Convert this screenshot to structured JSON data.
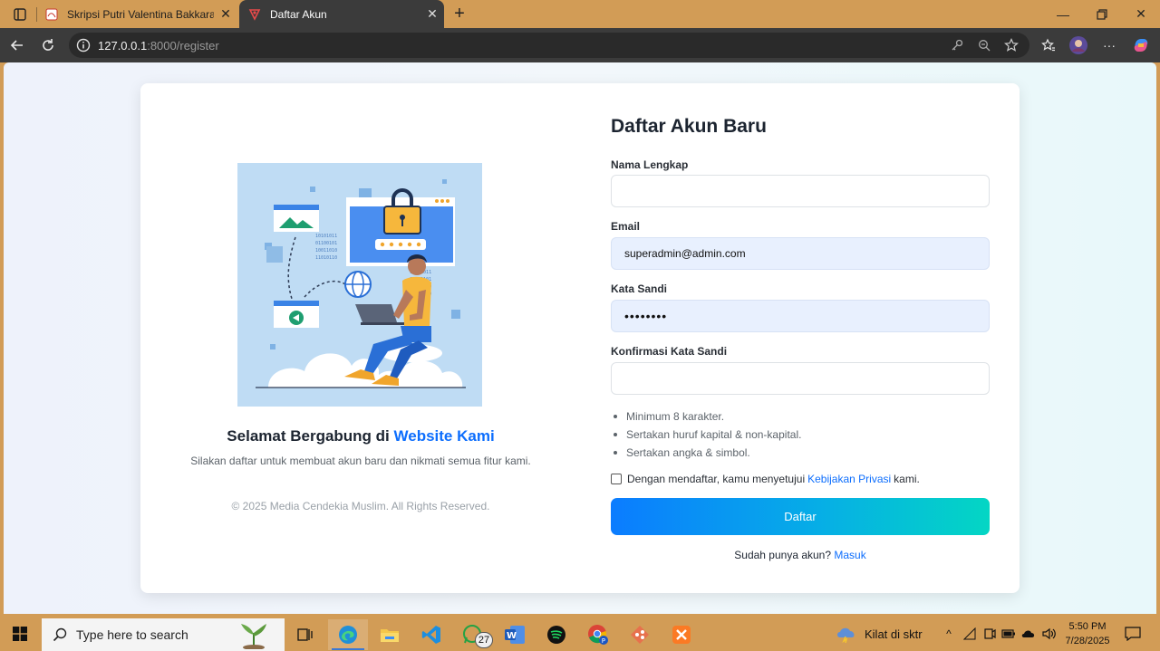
{
  "browser": {
    "tabs": [
      {
        "title": "Skripsi Putri Valentina Bakkara_21",
        "active": false
      },
      {
        "title": "Daftar Akun",
        "active": true
      }
    ],
    "url_host": "127.0.0.1",
    "url_rest": ":8000/register"
  },
  "left": {
    "welcome_prefix": "Selamat Bergabung di",
    "welcome_highlight": "Website Kami",
    "subtext": "Silakan daftar untuk membuat akun baru dan nikmati semua fitur kami.",
    "copyright": "© 2025 Media Cendekia Muslim. All Rights Reserved."
  },
  "form": {
    "title": "Daftar Akun Baru",
    "name_label": "Nama Lengkap",
    "name_value": "",
    "email_label": "Email",
    "email_value": "superadmin@admin.com",
    "password_label": "Kata Sandi",
    "password_value": "••••••••",
    "confirm_label": "Konfirmasi Kata Sandi",
    "confirm_value": "",
    "rules": [
      "Minimum 8 karakter.",
      "Sertakan huruf kapital & non-kapital.",
      "Sertakan angka & simbol."
    ],
    "agree_prefix": "Dengan mendaftar, kamu menyetujui",
    "agree_link": "Kebijakan Privasi",
    "agree_suffix": "kami.",
    "agree_checked": false,
    "submit_label": "Daftar",
    "login_prefix": "Sudah punya akun?",
    "login_link": "Masuk"
  },
  "taskbar": {
    "search_placeholder": "Type here to search",
    "whatsapp_badge": "27",
    "weather": "Kilat di sktr",
    "time": "5:50 PM",
    "date": "7/28/2025"
  },
  "colors": {
    "accent": "#0d6efd",
    "button_start": "#0b7cff",
    "button_end": "#04d6c4",
    "frame": "#d29c56"
  }
}
